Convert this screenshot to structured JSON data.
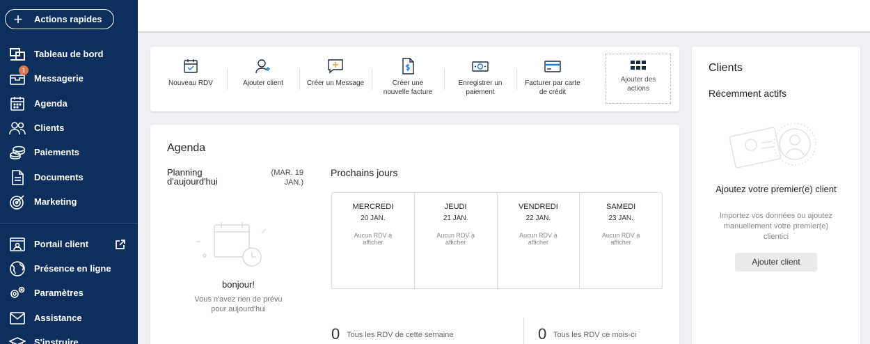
{
  "sidebar": {
    "quick_actions": "Actions rapides",
    "items": [
      {
        "label": "Tableau de bord",
        "icon": "dashboard-icon"
      },
      {
        "label": "Messagerie",
        "icon": "messages-icon",
        "badge": "1"
      },
      {
        "label": "Agenda",
        "icon": "calendar-icon"
      },
      {
        "label": "Clients",
        "icon": "clients-icon"
      },
      {
        "label": "Paiements",
        "icon": "payments-icon"
      },
      {
        "label": "Documents",
        "icon": "documents-icon"
      },
      {
        "label": "Marketing",
        "icon": "marketing-icon"
      }
    ],
    "items2": [
      {
        "label": "Portail client",
        "icon": "portal-icon"
      },
      {
        "label": "Présence en ligne",
        "icon": "globe-icon"
      },
      {
        "label": "Paramètres",
        "icon": "settings-icon"
      },
      {
        "label": "Assistance",
        "icon": "support-icon"
      },
      {
        "label": "S'instruire",
        "icon": "learn-icon"
      }
    ]
  },
  "actions": [
    {
      "label": "Nouveau RDV",
      "icon": "calendar-check-icon"
    },
    {
      "label": "Ajouter client",
      "icon": "add-user-icon"
    },
    {
      "label": "Créer un Message",
      "icon": "message-add-icon"
    },
    {
      "label": "Créer une nouvelle facture",
      "icon": "invoice-icon"
    },
    {
      "label": "Enregistrer un paiement",
      "icon": "cash-icon"
    },
    {
      "label": "Facturer par carte de crédit",
      "icon": "credit-card-icon"
    },
    {
      "label": "Ajouter des actions",
      "icon": "grid-icon"
    }
  ],
  "agenda": {
    "title": "Agenda",
    "planning": "Planning d'aujourd'hui",
    "date": "(MAR. 19 JAN.)",
    "hello": "bonjour!",
    "hello_sub": "Vous n'avez rien de prévu pour aujourd'hui",
    "next_title": "Prochains jours",
    "days": [
      {
        "name": "MERCREDI",
        "date": "20 JAN.",
        "none": "Aucun RDV à afficher"
      },
      {
        "name": "JEUDI",
        "date": "21 JAN.",
        "none": "Aucun RDV à afficher"
      },
      {
        "name": "VENDREDI",
        "date": "22 JAN.",
        "none": "Aucun RDV à afficher"
      },
      {
        "name": "SAMEDI",
        "date": "23 JAN.",
        "none": "Aucun RDV à afficher"
      }
    ],
    "stats": [
      {
        "value": "0",
        "label": "Tous les RDV de cette semaine"
      },
      {
        "value": "0",
        "label": "Tous les RDV ce mois-ci"
      }
    ]
  },
  "clients": {
    "title": "Clients",
    "recent": "Récemment actifs",
    "empty_title": "Ajoutez votre premier(e) client",
    "empty_sub": "Importez vos données ou ajoutez manuellement votre premier(e) clientici",
    "add_button": "Ajouter client"
  },
  "colors": {
    "sidebar": "#0c2f5e",
    "badge": "#e0734d",
    "accent": "#1c7ad9"
  }
}
